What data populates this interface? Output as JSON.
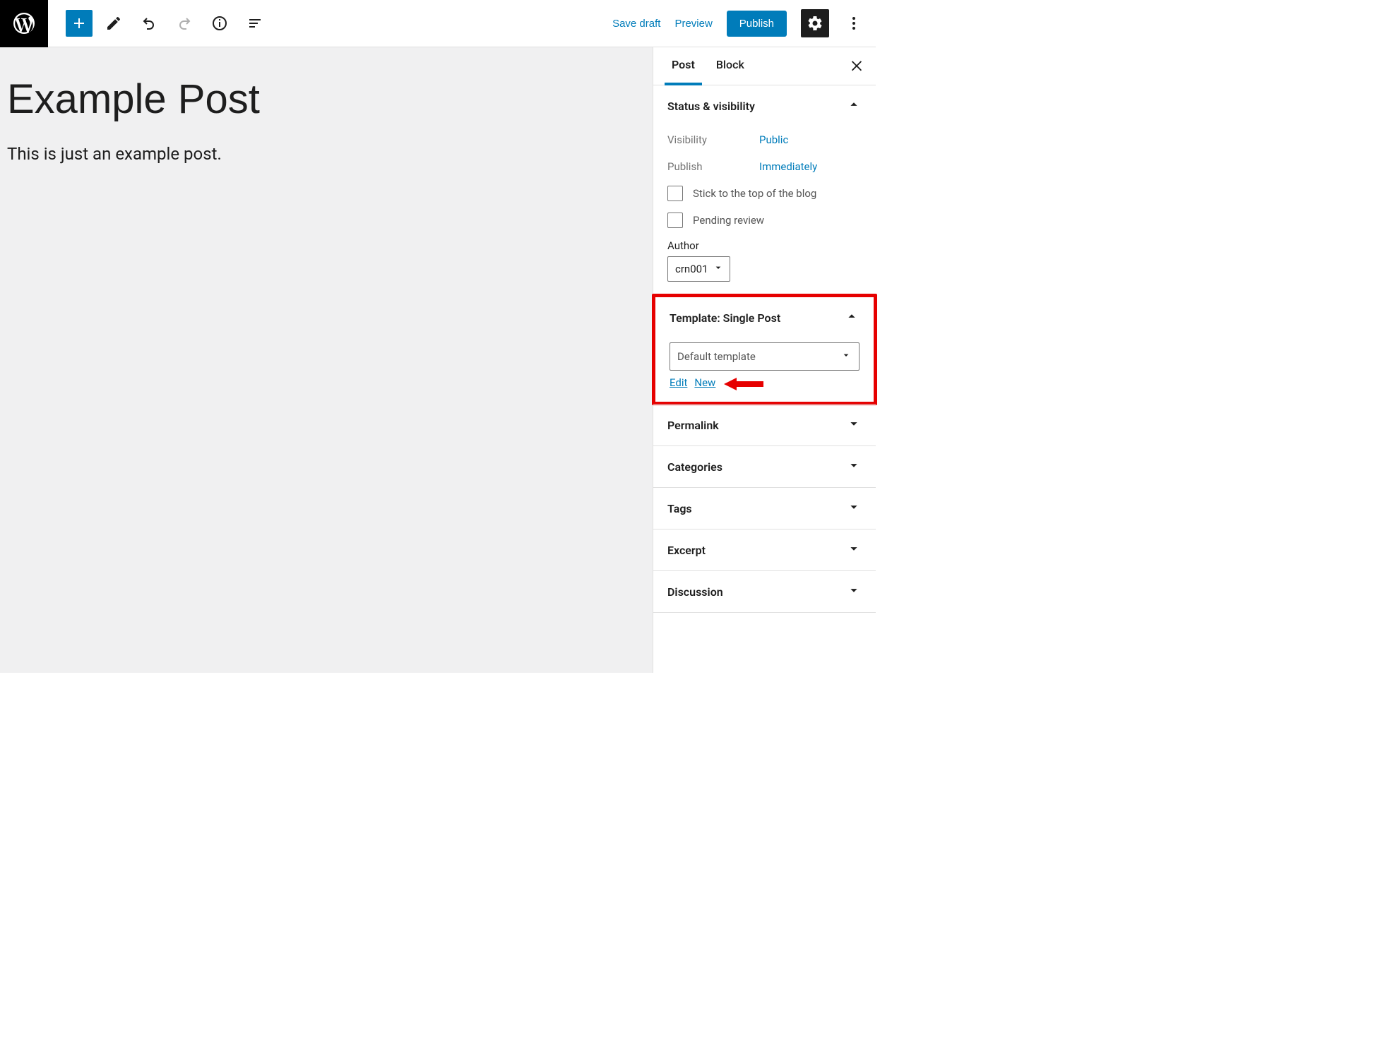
{
  "toolbar": {
    "save_draft": "Save draft",
    "preview": "Preview",
    "publish": "Publish"
  },
  "editor": {
    "title": "Example Post",
    "body": "This is just an example post."
  },
  "sidebar": {
    "tabs": {
      "post": "Post",
      "block": "Block"
    },
    "panels": {
      "status": {
        "title": "Status & visibility",
        "visibility_label": "Visibility",
        "visibility_value": "Public",
        "publish_label": "Publish",
        "publish_value": "Immediately",
        "stick_label": "Stick to the top of the blog",
        "pending_label": "Pending review",
        "author_label": "Author",
        "author_value": "crn001"
      },
      "template": {
        "title": "Template: Single Post",
        "select_value": "Default template",
        "edit": "Edit",
        "new": "New"
      },
      "permalink": "Permalink",
      "categories": "Categories",
      "tags": "Tags",
      "excerpt": "Excerpt",
      "discussion": "Discussion"
    }
  }
}
